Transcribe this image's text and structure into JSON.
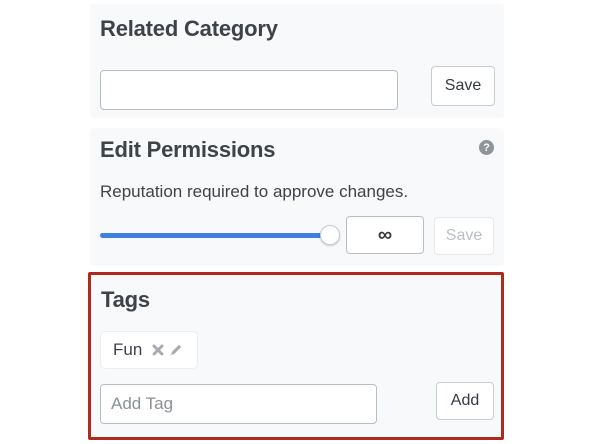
{
  "related_category": {
    "title": "Related Category",
    "input_value": "",
    "save_label": "Save"
  },
  "edit_permissions": {
    "title": "Edit Permissions",
    "help_icon": "question-circle-icon",
    "help_glyph": "?",
    "description": "Reputation required to approve changes.",
    "slider_value_fraction": 1.0,
    "reputation_value": "∞",
    "save_label": "Save",
    "save_disabled": true,
    "accent_color": "#3f7fe0"
  },
  "tags": {
    "title": "Tags",
    "highlight_color": "#b02a1c",
    "items": [
      {
        "label": "Fun",
        "remove_icon": "x-icon",
        "edit_icon": "pencil-icon"
      }
    ],
    "add_placeholder": "Add Tag",
    "add_label": "Add"
  }
}
